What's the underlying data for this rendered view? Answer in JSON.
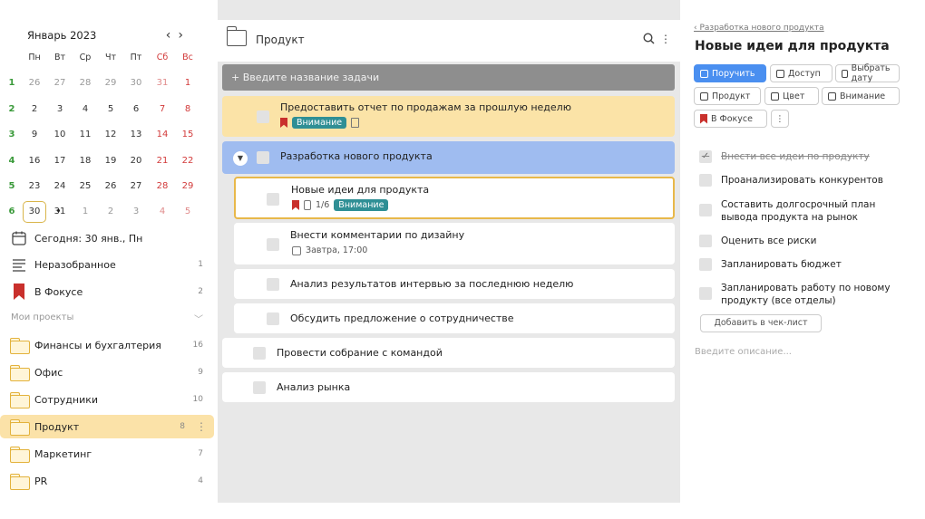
{
  "calendar": {
    "title": "Январь 2023",
    "prev": "‹",
    "next": "›",
    "weekdays": [
      "Пн",
      "Вт",
      "Ср",
      "Чт",
      "Пт",
      "Сб",
      "Вс"
    ],
    "weeks": [
      {
        "num": "1",
        "days": [
          "26",
          "27",
          "28",
          "29",
          "30",
          "31",
          "1"
        ]
      },
      {
        "num": "2",
        "days": [
          "2",
          "3",
          "4",
          "5",
          "6",
          "7",
          "8"
        ]
      },
      {
        "num": "3",
        "days": [
          "9",
          "10",
          "11",
          "12",
          "13",
          "14",
          "15"
        ]
      },
      {
        "num": "4",
        "days": [
          "16",
          "17",
          "18",
          "19",
          "20",
          "21",
          "22"
        ]
      },
      {
        "num": "5",
        "days": [
          "23",
          "24",
          "25",
          "26",
          "27",
          "28",
          "29"
        ]
      },
      {
        "num": "6",
        "days": [
          "30",
          "31",
          "1",
          "2",
          "3",
          "4",
          "5"
        ]
      }
    ]
  },
  "sidebar": {
    "today": "Сегодня: 30 янв., Пн",
    "inbox": {
      "label": "Неразобранное",
      "count": "1"
    },
    "focus": {
      "label": "В Фокусе",
      "count": "2"
    },
    "projects_label": "Мои проекты",
    "projects": [
      {
        "label": "Финансы и бухгалтерия",
        "count": "16"
      },
      {
        "label": "Офис",
        "count": "9"
      },
      {
        "label": "Сотрудники",
        "count": "10"
      },
      {
        "label": "Продукт",
        "count": "8"
      },
      {
        "label": "Маркетинг",
        "count": "7"
      },
      {
        "label": "PR",
        "count": "4"
      }
    ]
  },
  "main": {
    "title": "Продукт",
    "add_placeholder": "+ Введите название задачи",
    "tasks": [
      {
        "title": "Предоставить отчет по продажам за прошлую неделю",
        "badge": "Внимание"
      },
      {
        "title": "Разработка нового продукта"
      },
      {
        "title": "Новые идеи для продукта",
        "progress": "1/6",
        "badge": "Внимание"
      },
      {
        "title": "Внести комментарии по дизайну",
        "due": "Завтра, 17:00"
      },
      {
        "title": "Анализ результатов интервью за последнюю неделю"
      },
      {
        "title": "Обсудить предложение о сотрудничестве"
      },
      {
        "title": "Провести собрание с командой"
      },
      {
        "title": "Анализ рынка"
      }
    ]
  },
  "detail": {
    "breadcrumb": "Разработка нового продукта",
    "title": "Новые идеи для продукта",
    "buttons": {
      "assign": "Поручить",
      "access": "Доступ",
      "date": "Выбрать дату",
      "project": "Продукт",
      "color": "Цвет",
      "attention": "Внимание",
      "focus": "В Фокусе",
      "more": "⋮"
    },
    "checklist": [
      {
        "text": "Внести все идеи по продукту",
        "done": true
      },
      {
        "text": "Проанализировать конкурентов"
      },
      {
        "text": "Составить долгосрочный план вывода продукта на рынок"
      },
      {
        "text": "Оценить все риски"
      },
      {
        "text": "Запланировать бюджет"
      },
      {
        "text": "Запланировать работу по новому продукту (все отделы)"
      }
    ],
    "add_checklist": "Добавить в чек-лист",
    "description_placeholder": "Введите описание..."
  },
  "colors": {
    "accent": "#4a8ff0",
    "badge": "#2f8f95",
    "highlight": "#fbe3a7",
    "group": "#9fbcf0",
    "folder": "#e3b23c"
  }
}
